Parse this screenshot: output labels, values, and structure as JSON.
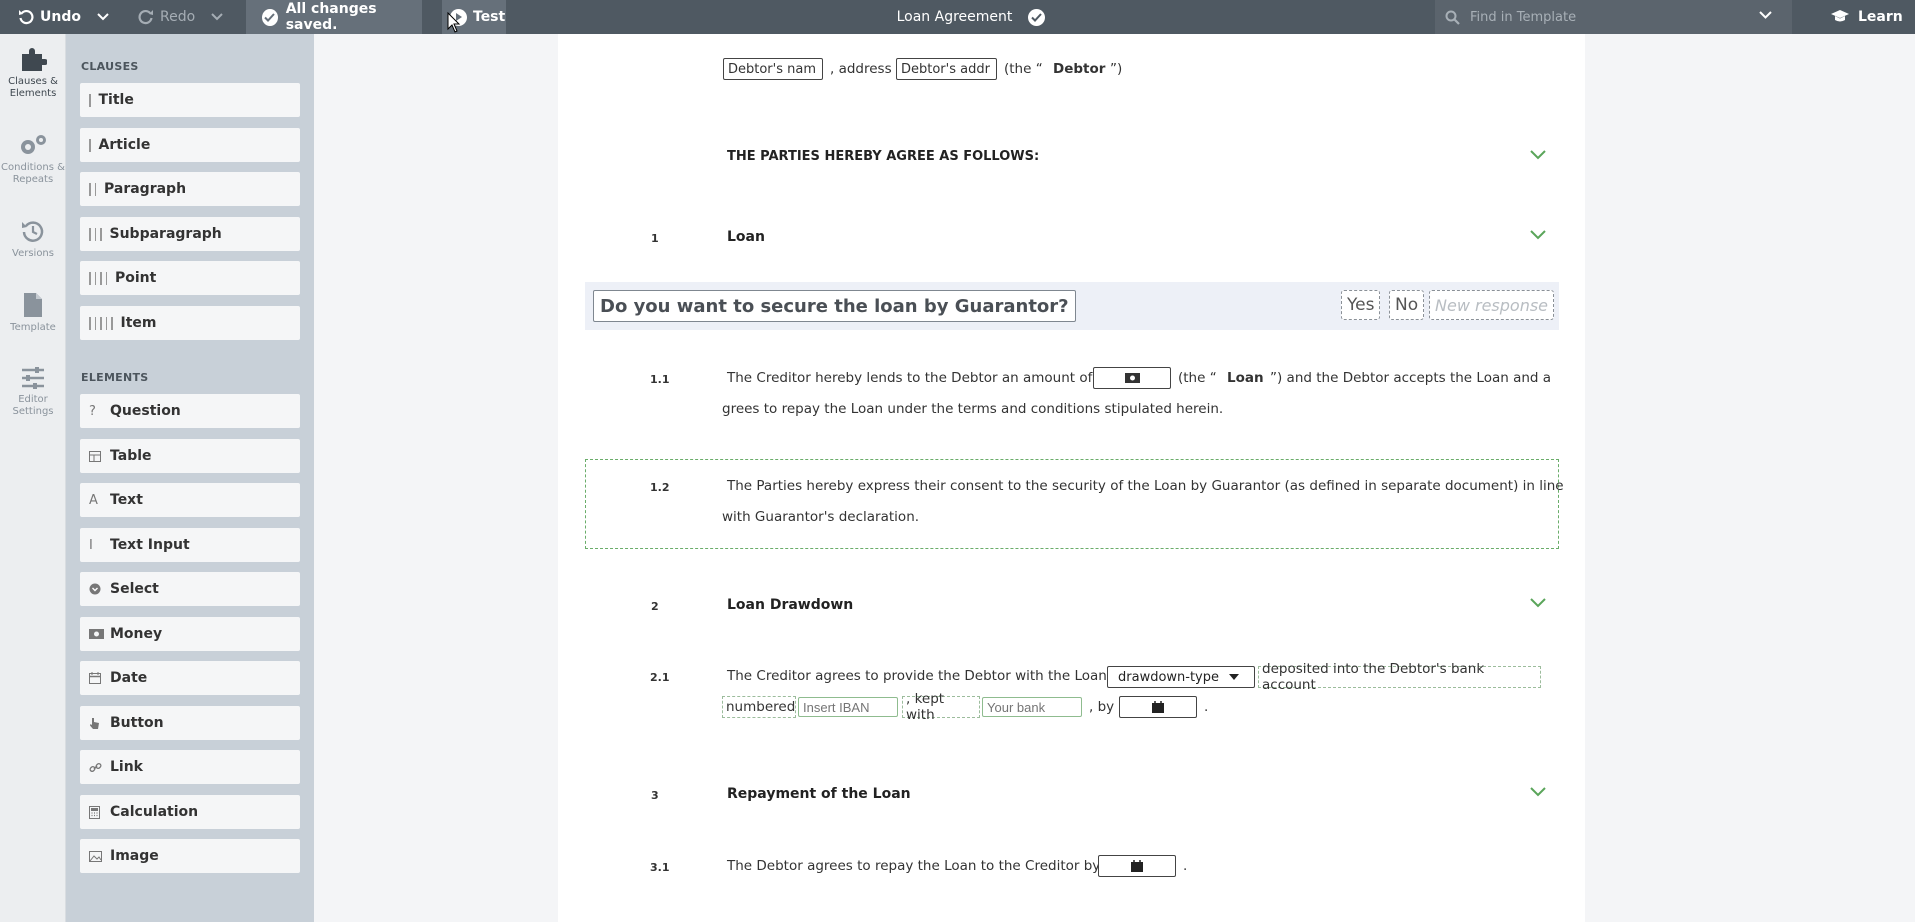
{
  "toolbar": {
    "undo_label": "Undo",
    "redo_label": "Redo",
    "saved_label": "All changes saved.",
    "test_label": "Test",
    "document_title": "Loan Agreement",
    "find_placeholder": "Find in Template",
    "learn_label": "Learn"
  },
  "rail": {
    "clauses": "Clauses & Elements",
    "conditions": "Conditions & Repeats",
    "versions": "Versions",
    "template": "Template",
    "editor_settings": "Editor Settings"
  },
  "palette": {
    "clauses_header": "CLAUSES",
    "clauses": [
      "Title",
      "Article",
      "Paragraph",
      "Subparagraph",
      "Point",
      "Item"
    ],
    "elements_header": "ELEMENTS",
    "elements": [
      "Question",
      "Table",
      "Text",
      "Text Input",
      "Select",
      "Money",
      "Date",
      "Button",
      "Link",
      "Calculation",
      "Image"
    ]
  },
  "document": {
    "debtor_line": {
      "name_field": "Debtor's nam",
      "address_text": ", address",
      "address_field": "Debtor's addr",
      "the_open": "(the “",
      "debtor_bold": "Debtor",
      "close": "”)"
    },
    "agree_heading": "THE PARTIES HEREBY AGREE AS FOLLOWS:",
    "section1": {
      "num": "1",
      "title": "Loan"
    },
    "question": {
      "text": "Do you want to secure the loan by Guarantor?",
      "yes": "Yes",
      "no": "No",
      "new": "New response"
    },
    "p11": {
      "num": "1.1",
      "text_a": "The Creditor hereby lends to the Debtor an amount of",
      "the_open": "(the “",
      "loan_bold": "Loan",
      "text_b": "”) and the Debtor accepts the Loan and a",
      "text_c": "grees to repay the Loan under the terms and conditions stipulated herein."
    },
    "p12": {
      "num": "1.2",
      "text_a": "The Parties hereby express their consent to the security of the Loan by Guarantor (as defined in separate document) in line",
      "text_b": "with Guarantor's declaration."
    },
    "section2": {
      "num": "2",
      "title": "Loan Drawdown"
    },
    "p21": {
      "num": "2.1",
      "text_a": "The Creditor agrees to provide the Debtor with the Loan",
      "select_value": "drawdown-type",
      "text_b": "deposited into the Debtor's bank account",
      "text_c": "numbered",
      "iban_placeholder": "Insert IBAN",
      "text_d": ", kept with",
      "bank_placeholder": "Your bank",
      "text_e": ", by",
      "end": "."
    },
    "section3": {
      "num": "3",
      "title": "Repayment of the Loan"
    },
    "p31": {
      "num": "3.1",
      "text_a": "The Debtor agrees to repay the Loan to the Creditor by",
      "end": "."
    }
  }
}
